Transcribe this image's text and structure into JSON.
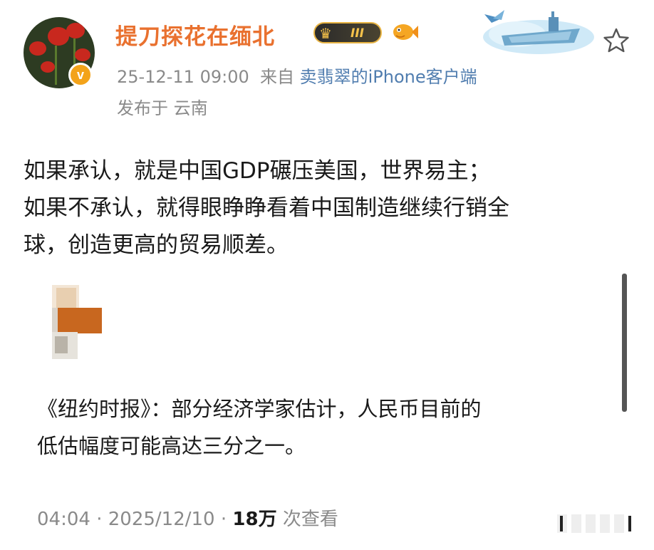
{
  "post": {
    "username": "提刀探花在缅北",
    "vip_level": "III",
    "timestamp": "25-12-11 09:00",
    "source_prefix": "来自",
    "source": "卖翡翠的iPhone客户端",
    "location": "发布于 云南",
    "verified_mark": "v",
    "body_lines": [
      "如果承认，就是中国GDP碾压美国，世界易主；",
      "如果不承认，就得眼睁睁看着中国制造继续行销全",
      "球，创造更高的贸易顺差。"
    ]
  },
  "quote": {
    "lines": [
      "《纽约时报》：部分经济学家估计，人民币目前的",
      "低估幅度可能高达三分之一。"
    ]
  },
  "footer": {
    "time": "04:04",
    "separator": "·",
    "date": "2025/12/10",
    "views": "18万",
    "views_suffix": "次查看"
  },
  "colors": {
    "username": "#e9712f",
    "source_link": "#507daf",
    "meta_gray": "#8a8a8a",
    "verified": "#f3a31a"
  },
  "icons": [
    "star-icon",
    "crown-icon",
    "fish-icon",
    "aircraft-carrier-decoration"
  ]
}
